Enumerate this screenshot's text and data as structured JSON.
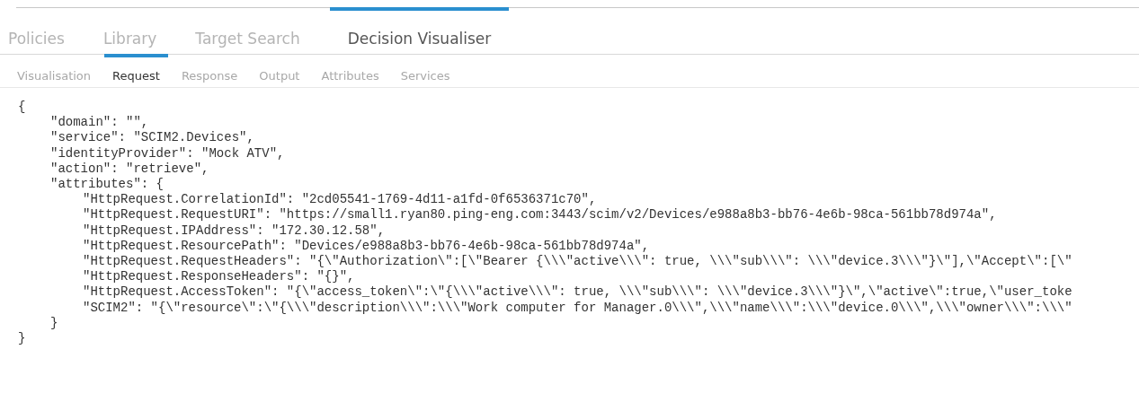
{
  "tabs": [
    {
      "label": "Policies",
      "selected": false
    },
    {
      "label": "Library",
      "selected": false
    },
    {
      "label": "Target Search",
      "selected": false
    },
    {
      "label": "Decision Visualiser",
      "selected": true
    }
  ],
  "subtabs": [
    {
      "label": "Visualisation",
      "selected": false
    },
    {
      "label": "Request",
      "selected": true
    },
    {
      "label": "Response",
      "selected": false
    },
    {
      "label": "Output",
      "selected": false
    },
    {
      "label": "Attributes",
      "selected": false
    },
    {
      "label": "Services",
      "selected": false
    }
  ],
  "code": [
    {
      "text": "{",
      "children": [
        {
          "text": "\"domain\": \"\","
        },
        {
          "text": "\"service\": \"SCIM2.Devices\","
        },
        {
          "text": "\"identityProvider\": \"Mock ATV\","
        },
        {
          "text": "\"action\": \"retrieve\","
        },
        {
          "text": "\"attributes\": {",
          "children": [
            {
              "text": "\"HttpRequest.CorrelationId\": \"2cd05541-1769-4d11-a1fd-0f6536371c70\","
            },
            {
              "text": "\"HttpRequest.RequestURI\": \"https://small1.ryan80.ping-eng.com:3443/scim/v2/Devices/e988a8b3-bb76-4e6b-98ca-561bb78d974a\","
            },
            {
              "text": "\"HttpRequest.IPAddress\": \"172.30.12.58\","
            },
            {
              "text": "\"HttpRequest.ResourcePath\": \"Devices/e988a8b3-bb76-4e6b-98ca-561bb78d974a\","
            },
            {
              "text": "\"HttpRequest.RequestHeaders\": \"{\\\"Authorization\\\":[\\\"Bearer {\\\\\\\"active\\\\\\\": true, \\\\\\\"sub\\\\\\\": \\\\\\\"device.3\\\\\\\"}\\\"],\\\"Accept\\\":[\\\""
            },
            {
              "text": "\"HttpRequest.ResponseHeaders\": \"{}\","
            },
            {
              "text": "\"HttpRequest.AccessToken\": \"{\\\"access_token\\\":\\\"{\\\\\\\"active\\\\\\\": true, \\\\\\\"sub\\\\\\\": \\\\\\\"device.3\\\\\\\"}\\\",\\\"active\\\":true,\\\"user_toke"
            },
            {
              "text": "\"SCIM2\": \"{\\\"resource\\\":\\\"{\\\\\\\"description\\\\\\\":\\\\\\\"Work computer for Manager.0\\\\\\\",\\\\\\\"name\\\\\\\":\\\\\\\"device.0\\\\\\\",\\\\\\\"owner\\\\\\\":\\\\\\\""
            }
          ]
        },
        {
          "text": "}"
        }
      ]
    },
    {
      "text": "}"
    }
  ]
}
